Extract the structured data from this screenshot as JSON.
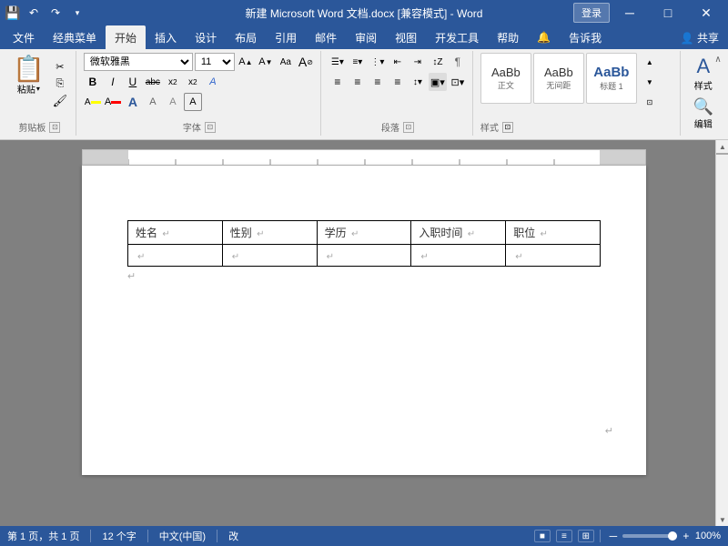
{
  "titlebar": {
    "save_icon": "💾",
    "undo_icon": "↶",
    "redo_icon": "↷",
    "customize_icon": "▾",
    "title": "新建 Microsoft Word 文档.docx [兼容模式] - Word",
    "login_label": "登录",
    "minimize_icon": "─",
    "maximize_icon": "□",
    "close_icon": "✕"
  },
  "menubar": {
    "items": [
      {
        "label": "文件",
        "active": false
      },
      {
        "label": "经典菜单",
        "active": false
      },
      {
        "label": "开始",
        "active": true
      },
      {
        "label": "插入",
        "active": false
      },
      {
        "label": "设计",
        "active": false
      },
      {
        "label": "布局",
        "active": false
      },
      {
        "label": "引用",
        "active": false
      },
      {
        "label": "邮件",
        "active": false
      },
      {
        "label": "审阅",
        "active": false
      },
      {
        "label": "视图",
        "active": false
      },
      {
        "label": "开发工具",
        "active": false
      },
      {
        "label": "帮助",
        "active": false
      },
      {
        "label": "🔔",
        "active": false
      },
      {
        "label": "告诉我",
        "active": false
      },
      {
        "label": "👤 共享",
        "active": false
      }
    ]
  },
  "ribbon": {
    "clipboard_group": {
      "label": "剪贴板",
      "paste_label": "粘贴",
      "cut_label": "✂",
      "copy_label": "⎘",
      "format_painter_label": "🖌"
    },
    "font_group": {
      "label": "字体",
      "font_name": "微软雅黑",
      "font_size": "11",
      "grow_label": "A▲",
      "shrink_label": "A▼",
      "clear_label": "A⊘",
      "bold_label": "B",
      "italic_label": "I",
      "underline_label": "U",
      "strikethrough_label": "abc",
      "subscript_label": "x₂",
      "superscript_label": "x²",
      "color_label": "A"
    },
    "paragraph_group": {
      "label": "段落"
    },
    "styles_group": {
      "label": "样式",
      "styles_label": "样式"
    },
    "editing_group": {
      "label": "",
      "find_label": "编辑"
    }
  },
  "table": {
    "headers": [
      "姓名",
      "性别",
      "学历",
      "入职时间",
      "职位"
    ],
    "row": [
      "",
      "",
      "",
      "",
      ""
    ],
    "para_mark": "↵",
    "cursor_mark": "↵"
  },
  "statusbar": {
    "page_info": "第 1 页，共 1 页",
    "word_count": "12 个字",
    "language": "中文(中国)",
    "input_mode": "改",
    "view_icons": [
      "■",
      "≡",
      "⊞"
    ],
    "zoom_percent": "100%",
    "zoom_minus": "─",
    "zoom_plus": "+"
  }
}
